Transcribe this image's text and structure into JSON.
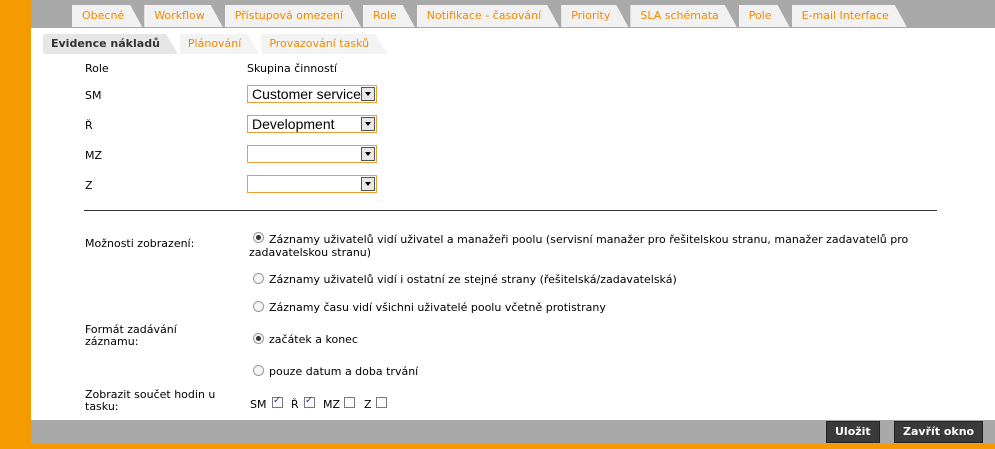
{
  "top_tabs": [
    "Obecné",
    "Workflow",
    "Přístupová omezení",
    "Role",
    "Notifikace - časování",
    "Priority",
    "SLA schémata",
    "Pole",
    "E-mail Interface"
  ],
  "sub_tabs": [
    "Evidence nákladů",
    "Plánování",
    "Provazování tasků"
  ],
  "table": {
    "header_role": "Role",
    "header_group": "Skupina činností",
    "rows": [
      {
        "role": "SM",
        "value": "Customer service"
      },
      {
        "role": "Ř",
        "value": "Development"
      },
      {
        "role": "MZ",
        "value": ""
      },
      {
        "role": "Z",
        "value": ""
      }
    ]
  },
  "display_options": {
    "label": "Možnosti zobrazení:",
    "options": [
      {
        "text": "Záznamy uživatelů vidí uživatel a manažeři poolu (servisní manažer pro řešitelskou stranu, manažer zadavatelů pro",
        "text2": "zadavatelskou stranu)",
        "selected": true
      },
      {
        "text": "Záznamy uživatelů vidí i ostatní ze stejné strany (řešitelská/zadavatelská)",
        "selected": false
      },
      {
        "text": "Záznamy času vidí všichni uživatelé poolu včetně protistrany",
        "selected": false
      }
    ]
  },
  "entry_format": {
    "label_line1": "Formát zadávání",
    "label_line2": "záznamu:",
    "options": [
      {
        "text": "začátek a konec",
        "selected": true
      },
      {
        "text": "pouze datum a doba trvání",
        "selected": false
      }
    ]
  },
  "hours_sum": {
    "label_line1": "Zobrazit součet hodin u",
    "label_line2": "tasku:",
    "items": [
      {
        "label": "SM",
        "checked": true
      },
      {
        "label": "Ř",
        "checked": true
      },
      {
        "label": "MZ",
        "checked": false
      },
      {
        "label": "Z",
        "checked": false
      }
    ]
  },
  "buttons": {
    "save": "Uložit",
    "close": "Zavřít okno"
  }
}
